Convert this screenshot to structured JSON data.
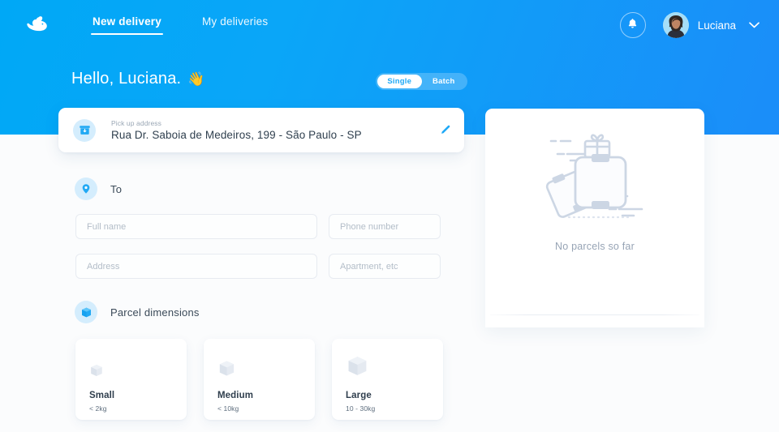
{
  "brand": {
    "logo_icon": "rabbit-logo-icon",
    "accent": "#1fa9f6",
    "header_gradient_from": "#00a8f6",
    "header_gradient_to": "#1b8df9"
  },
  "nav": {
    "tabs": [
      {
        "label": "New delivery",
        "active": true
      },
      {
        "label": "My deliveries",
        "active": false
      }
    ],
    "notifications_icon": "bell-icon",
    "user_name": "Luciana",
    "avatar_icon": "user-avatar",
    "chevron_icon": "chevron-down-icon"
  },
  "greeting": {
    "text": "Hello, Luciana.",
    "emoji": "👋"
  },
  "mode_toggle": {
    "options": [
      {
        "label": "Single",
        "selected": true
      },
      {
        "label": "Batch",
        "selected": false
      }
    ]
  },
  "pickup": {
    "icon": "package-pickup-icon",
    "label": "Pick up address",
    "value": "Rua Dr. Saboia de Medeiros, 199 - São Paulo - SP",
    "edit_icon": "pencil-edit-icon"
  },
  "to_section": {
    "icon": "map-pin-icon",
    "title": "To",
    "fields": [
      {
        "name": "full-name",
        "placeholder": "Full name",
        "value": ""
      },
      {
        "name": "phone-number",
        "placeholder": "Phone number",
        "value": ""
      },
      {
        "name": "address",
        "placeholder": "Address",
        "value": ""
      },
      {
        "name": "apartment",
        "placeholder": "Apartment, etc",
        "value": ""
      }
    ]
  },
  "parcel_section": {
    "icon": "parcel-box-icon",
    "title": "Parcel dimensions",
    "options": [
      {
        "name": "Small",
        "weight": "< 2kg",
        "selected": false
      },
      {
        "name": "Medium",
        "weight": "< 10kg",
        "selected": false
      },
      {
        "name": "Large",
        "weight": "10 - 30kg",
        "selected": false
      }
    ]
  },
  "parcels_panel": {
    "empty_illustration": "empty-parcels-illustration",
    "empty_text": "No parcels so far"
  }
}
